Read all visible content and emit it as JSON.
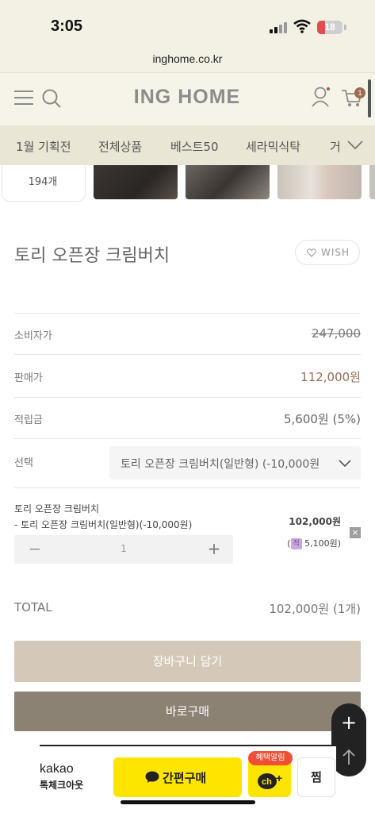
{
  "status_bar": {
    "time": "3:05",
    "battery": "18"
  },
  "browser": {
    "url": "inghome.co.kr"
  },
  "header": {
    "logo": "ING HOME",
    "cart_count": "1"
  },
  "category_nav": {
    "items": [
      "1월 기획전",
      "전체상품",
      "베스트50",
      "세라믹식탁",
      "거"
    ]
  },
  "reviews": {
    "count": "194개"
  },
  "product": {
    "title": "토리 오픈장 크림버치",
    "wish_label": "WISH",
    "rows": {
      "consumer_price_label": "소비자가",
      "consumer_price": "247,000",
      "sale_price_label": "판매가",
      "sale_price": "112,000원",
      "points_label": "적립금",
      "points": "5,600원 (5%)",
      "option_label": "선택",
      "option_value": "토리 오픈장 크림버치(일반형) (-10,000원"
    }
  },
  "selected_option": {
    "name": "토리 오픈장 크림버치",
    "sub": "- 토리 오픈장 크림버치(일반형)(-10,000원)",
    "price": "102,000원",
    "points_badge": "적",
    "points": "5,100원)",
    "points_prefix": "(",
    "quantity": "1",
    "minus": "−",
    "plus": "+",
    "remove": "×"
  },
  "total": {
    "label": "TOTAL",
    "value": "102,000원 (1개)"
  },
  "actions": {
    "cart": "장바구니 담기",
    "buy": "바로구매"
  },
  "kakao": {
    "logo": "kakao",
    "sub": "톡체크아웃",
    "buy": "간편구매",
    "badge": "혜택알림",
    "ch_label": "ch+",
    "zzim": "찜"
  },
  "fab": {
    "plus": "+"
  },
  "colors": {
    "accent": "#9b6b54",
    "cart_button": "#d4c9b9",
    "buy_button": "#8b8274",
    "kakao_yellow": "#fde500"
  }
}
